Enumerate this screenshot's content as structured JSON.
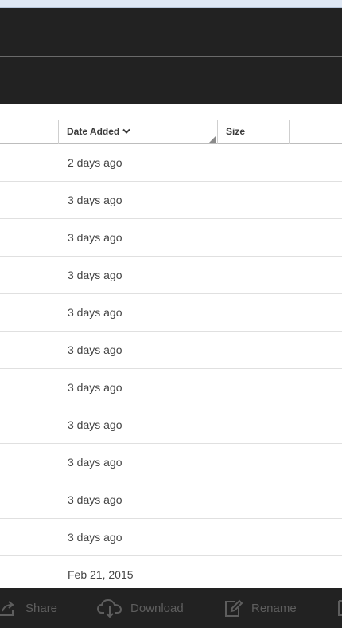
{
  "table": {
    "columns": {
      "date_added": "Date Added",
      "size": "Size"
    },
    "sort": "descending",
    "rows": [
      {
        "date_added": "2 days ago",
        "size": ""
      },
      {
        "date_added": "3 days ago",
        "size": ""
      },
      {
        "date_added": "3 days ago",
        "size": ""
      },
      {
        "date_added": "3 days ago",
        "size": ""
      },
      {
        "date_added": "3 days ago",
        "size": ""
      },
      {
        "date_added": "3 days ago",
        "size": ""
      },
      {
        "date_added": "3 days ago",
        "size": ""
      },
      {
        "date_added": "3 days ago",
        "size": ""
      },
      {
        "date_added": "3 days ago",
        "size": ""
      },
      {
        "date_added": "3 days ago",
        "size": ""
      },
      {
        "date_added": "3 days ago",
        "size": ""
      },
      {
        "date_added": "Feb 21, 2015",
        "size": ""
      }
    ]
  },
  "toolbar": {
    "share_label": "Share",
    "download_label": "Download",
    "rename_label": "Rename"
  },
  "icons": {
    "share": "share-icon",
    "download": "cloud-download-icon",
    "rename": "edit-icon",
    "sort": "chevron-down-icon"
  },
  "colors": {
    "header_background": "#222222",
    "toolbar_background": "#222222",
    "toolbar_text": "#5e5e5e",
    "row_text": "#444444"
  }
}
